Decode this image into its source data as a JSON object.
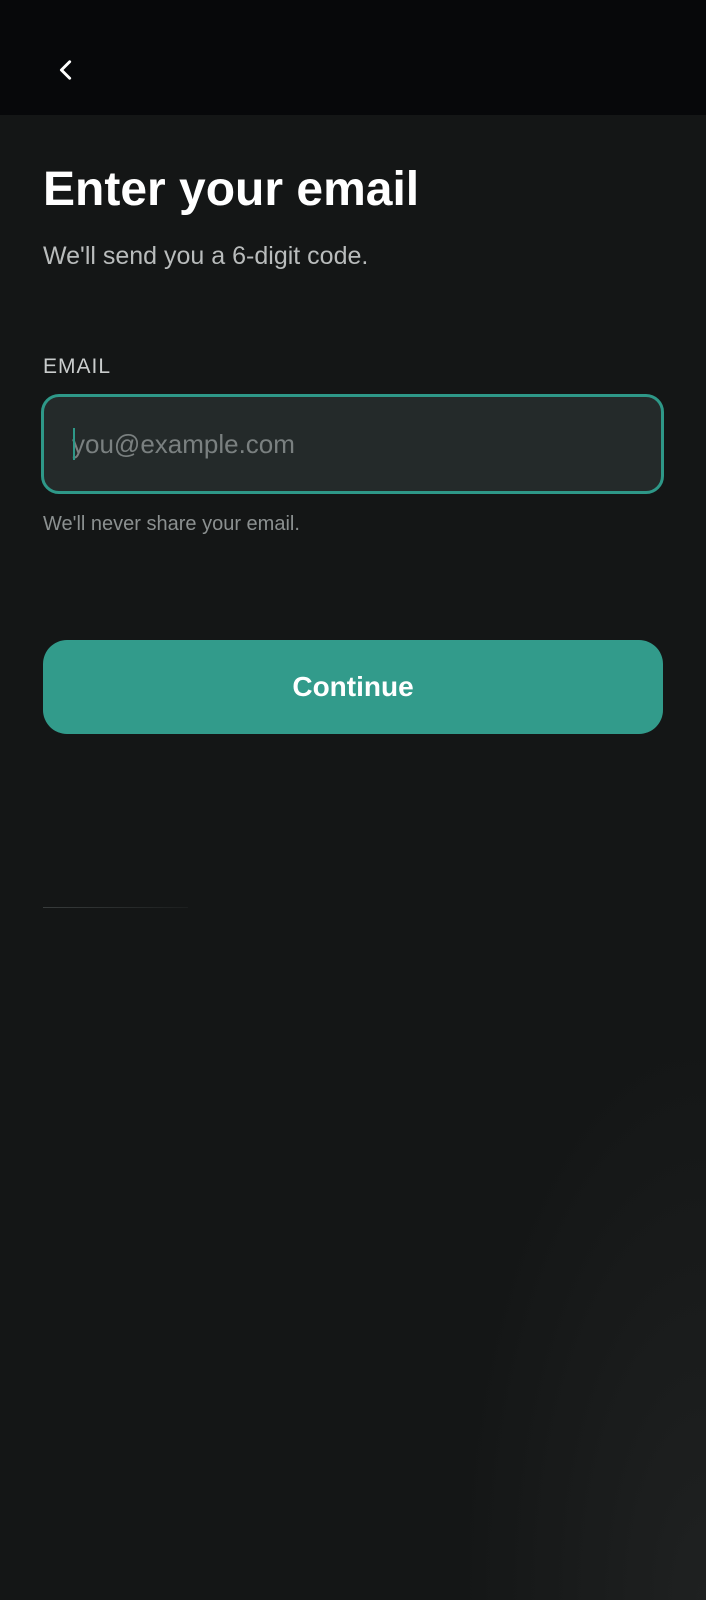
{
  "header": {
    "back_icon": "chevron-left-icon"
  },
  "main": {
    "title": "Enter your email",
    "subtitle": "We'll send you a 6-digit code.",
    "email_label": "EMAIL",
    "email_placeholder": "you@example.com",
    "email_value": "",
    "helper_text": "We'll never share your email.",
    "continue_label": "Continue"
  },
  "colors": {
    "accent": "#329b8b",
    "input_border": "#2e9888",
    "background": "#141616",
    "topbar": "#07080a"
  }
}
